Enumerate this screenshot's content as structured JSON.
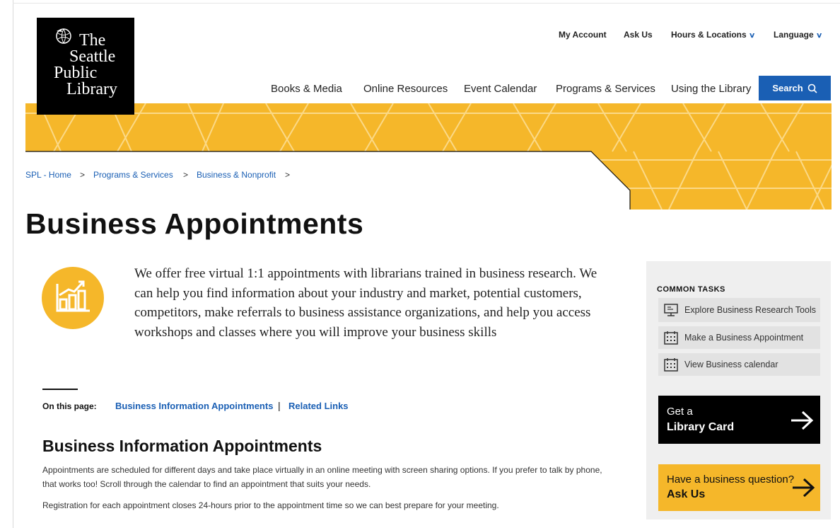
{
  "logo": {
    "lines": [
      "The",
      "Seattle",
      "Public",
      "Library"
    ]
  },
  "utility_nav": [
    {
      "label": "My Account"
    },
    {
      "label": "Ask Us"
    },
    {
      "label": "Hours & Locations",
      "dropdown": true
    },
    {
      "label": "Language",
      "dropdown": true
    }
  ],
  "main_nav": [
    "Books & Media",
    "Online Resources",
    "Event Calendar",
    "Programs & Services",
    "Using the Library"
  ],
  "search": {
    "label": "Search",
    "icon": "search-icon"
  },
  "breadcrumb": {
    "items": [
      "SPL - Home",
      "Programs & Services",
      "Business & Nonprofit"
    ],
    "separator": ">"
  },
  "page_title": "Business Appointments",
  "intro": {
    "icon": "chart-growth-icon",
    "text": "We offer free virtual 1:1 appointments with librarians trained in business research. We can help you find information about your industry and market, potential customers, competitors, make referrals to business assistance organizations, and help you access workshops and classes where you will improve your business skills"
  },
  "on_this_page": {
    "label": "On this page:",
    "links": [
      "Business Information Appointments",
      "Related Links"
    ],
    "separator": "|"
  },
  "section": {
    "heading": "Business Information Appointments",
    "paragraphs": [
      "Appointments are scheduled for different days and take place virtually in an online meeting with screen sharing options.  If you prefer to talk by phone, that works too!  Scroll through the calendar to find an appointment that suits your needs.",
      "Registration for each appointment closes 24-hours prior to the appointment time so we can best prepare for your meeting."
    ]
  },
  "sidebar": {
    "heading": "COMMON TASKS",
    "tasks": [
      {
        "label": "Explore Business Research Tools",
        "icon": "computer-icon"
      },
      {
        "label": "Make a Business Appointment",
        "icon": "calendar-icon"
      },
      {
        "label": "View Business calendar",
        "icon": "calendar-icon"
      }
    ],
    "cards": [
      {
        "small": "Get a",
        "big": "Library Card"
      },
      {
        "small": "Have a business question?",
        "big": "Ask Us"
      }
    ]
  },
  "colors": {
    "accent_blue": "#1a5fb4",
    "banner_yellow": "#f5b72a",
    "logo_black": "#000000",
    "sidebar_gray": "#efefef"
  }
}
